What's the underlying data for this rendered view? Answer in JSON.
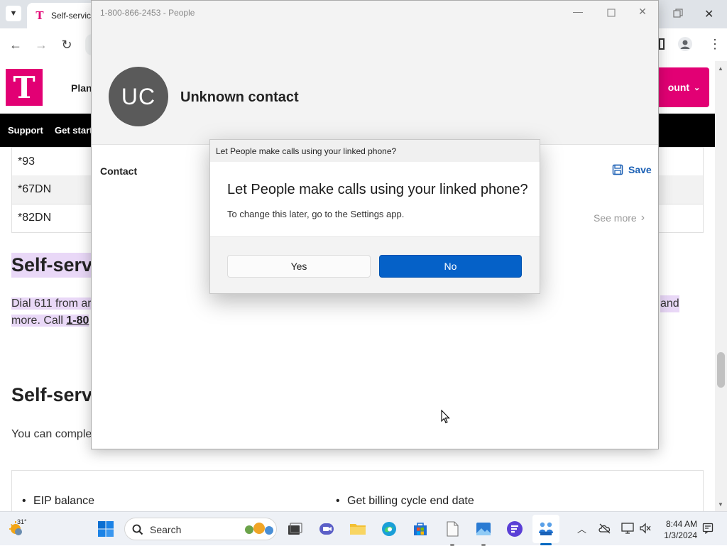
{
  "browser": {
    "tab_title": "Self-service",
    "nav": {
      "back": "←",
      "forward": "→",
      "reload": "↻"
    },
    "site": {
      "logo_letter": "T",
      "header_link": "Plans",
      "account_label": "ount",
      "nav_items": [
        "Support",
        "Get start"
      ],
      "table_rows": [
        "*93",
        "*67DN",
        "*82DN"
      ],
      "heading1": "Self-serv",
      "paragraph_line1_start": "Dial 611 from ar",
      "paragraph_line1_end": "and",
      "paragraph_line2_start": "more. Call ",
      "paragraph_link": "1-80",
      "heading2": "Self-serv",
      "paragraph2": "You can comple",
      "bullets": [
        "EIP balance",
        "Get billing cycle end date"
      ]
    }
  },
  "people": {
    "window_title": "1-800-866-2453 - People",
    "avatar_initials": "UC",
    "contact_name": "Unknown contact",
    "section_label": "Contact",
    "save_label": "Save",
    "see_more_label": "See more"
  },
  "dialog": {
    "title": "Let People make calls using your linked phone?",
    "heading": "Let People make calls using your linked phone?",
    "subtext": "To change this later, go to the Settings app.",
    "yes_label": "Yes",
    "no_label": "No"
  },
  "taskbar": {
    "weather_temp": "31°",
    "search_placeholder": "Search",
    "time": "8:44 AM",
    "date": "1/3/2024"
  },
  "colors": {
    "brand_magenta": "#e20074",
    "primary_blue": "#0561c8",
    "highlight_purple": "#e9d8f7"
  }
}
